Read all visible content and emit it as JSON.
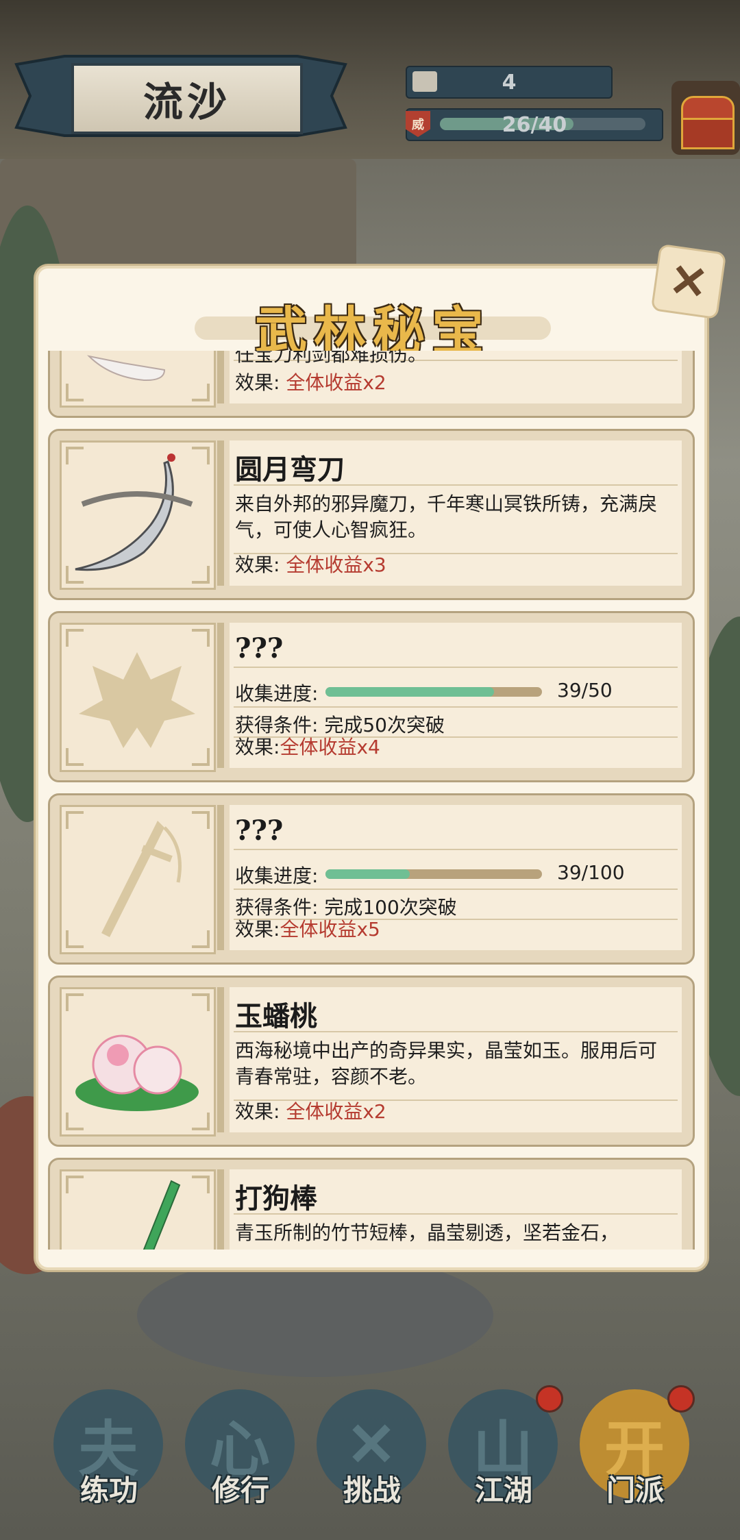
{
  "header": {
    "location": "流沙",
    "currency_value": "4",
    "prestige_badge": "威",
    "prestige_text": "26/40",
    "prestige_progress": 0.65,
    "chest_icon": "treasure-chest-icon"
  },
  "modal": {
    "title": "武林秘宝",
    "close_icon": "close-x-icon",
    "partial_top_text": "任宝刀利剑都难损伤。",
    "partial_top_effect_label": "效果: ",
    "partial_top_effect_value": "全体收益x2",
    "items": [
      {
        "name": "圆月弯刀",
        "desc": "来自外邦的邪异魔刀，千年寒山冥铁所铸，充满戾气，可使人心智疯狂。",
        "effect_label": "效果: ",
        "effect_value": "全体收益x3",
        "icon": "curved-sabre-icon"
      },
      {
        "name": "???",
        "progress_label": "收集进度:",
        "progress_value": 0.78,
        "progress_text": "39/50",
        "condition_label": "获得条件: ",
        "condition_value": "完成50次突破",
        "effect_label": "效果:",
        "effect_value": "全体收益x4",
        "icon": "locked-lotus-silhouette-icon"
      },
      {
        "name": "???",
        "progress_label": "收集进度:",
        "progress_value": 0.39,
        "progress_text": "39/100",
        "condition_label": "获得条件: ",
        "condition_value": "完成100次突破",
        "effect_label": "效果:",
        "effect_value": "全体收益x5",
        "icon": "locked-sword-silhouette-icon"
      },
      {
        "name": "玉蟠桃",
        "desc": "西海秘境中出产的奇异果实，晶莹如玉。服用后可青春常驻，容颜不老。",
        "effect_label": "效果: ",
        "effect_value": "全体收益x2",
        "icon": "jade-peach-icon"
      },
      {
        "name": "打狗棒",
        "desc": "青玉所制的竹节短棒，晶莹剔透，坚若金石，",
        "icon": "bamboo-staff-icon"
      }
    ]
  },
  "nav": [
    {
      "label": "练功",
      "glyph": "夫",
      "badge": false
    },
    {
      "label": "修行",
      "glyph": "心",
      "badge": false
    },
    {
      "label": "挑战",
      "glyph": "✕",
      "badge": false
    },
    {
      "label": "江湖",
      "glyph": "山",
      "badge": true
    },
    {
      "label": "门派",
      "glyph": "开",
      "badge": true,
      "active": true
    }
  ],
  "colors": {
    "effect_red": "#b53b30",
    "progress_green": "#6fbf94",
    "title_gold": "#e9b84b",
    "nav_blue": "#3a5661"
  }
}
